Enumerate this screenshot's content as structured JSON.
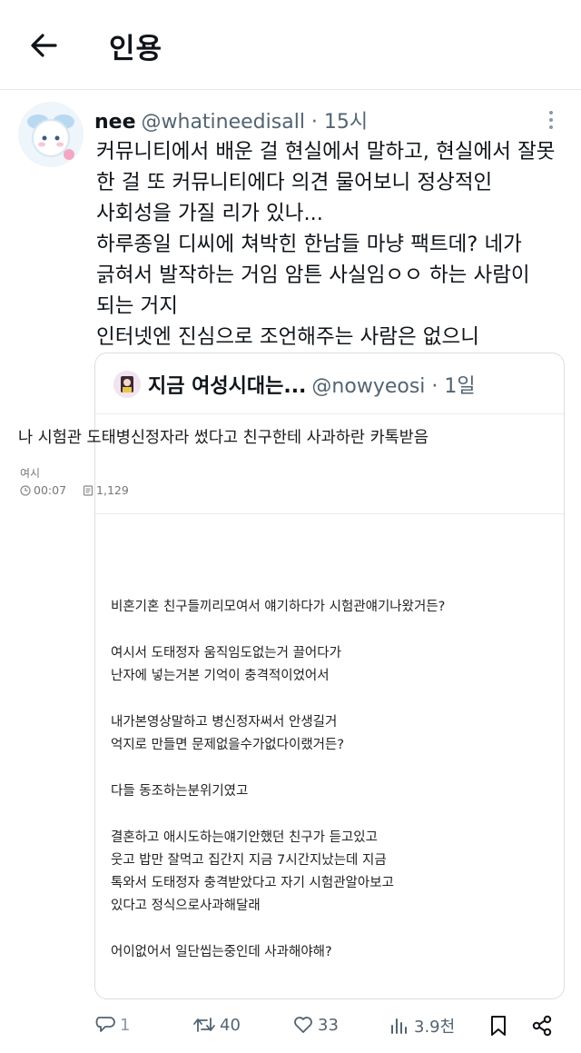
{
  "header": {
    "back_icon": "back-arrow-icon",
    "title": "인용"
  },
  "tweet": {
    "display_name": "nee",
    "handle_time": "@whatineedisall · 15시",
    "lines": [
      "커뮤니티에서 배운 걸 현실에서 말하고, 현실에서 잘못",
      "한 걸 또 커뮤니티에다 의견 물어보니 정상적인",
      "사회성을 가질 리가 있나...",
      "하루종일 디씨에 쳐박힌 한남들 마냥 팩트데? 네가",
      "긁혀서 발작하는 거임 암튼 사실임ㅇㅇ 하는 사람이",
      "되는 거지",
      "인터넷엔 진심으로 조언해주는 사람은 없으니"
    ]
  },
  "quote": {
    "display_name": "지금 여성시대는...",
    "handle_time": "@nowyeosi · 1일",
    "post_title": "나 시험관 도태병신정자라 썼다고 친구한테 사과하란 카톡받음",
    "board": "여시",
    "time": "00:07",
    "views": "1,129",
    "body": [
      "비혼기혼 친구들끼리모여서 얘기하다가 시험관얘기나왔거든?",
      "",
      "여시서 도태정자 움직임도없는거 끌어다가",
      "난자에 넣는거본 기억이 충격적이었어서",
      "",
      "내가본영상말하고 병신정자써서 안생길거",
      "억지로 만들면 문제없을수가없다이랬거든?",
      "",
      "다들 동조하는분위기였고",
      "",
      "결혼하고 애시도하는얘기안했던 친구가 듣고있고",
      "웃고 밥만 잘먹고 집간지 지금 7시간지났는데 지금",
      "톡와서 도태정자 충격받았다고 자기 시험관알아보고",
      "있다고 정식으로사과해달래",
      "",
      "어이없어서 일단씹는중인데 사과해야해?"
    ]
  },
  "actions": {
    "replies": "1",
    "retweets": "40",
    "likes": "33",
    "views": "3.9천"
  },
  "colors": {
    "text": "#0f1419",
    "muted": "#536471",
    "border": "#d9dee2"
  }
}
